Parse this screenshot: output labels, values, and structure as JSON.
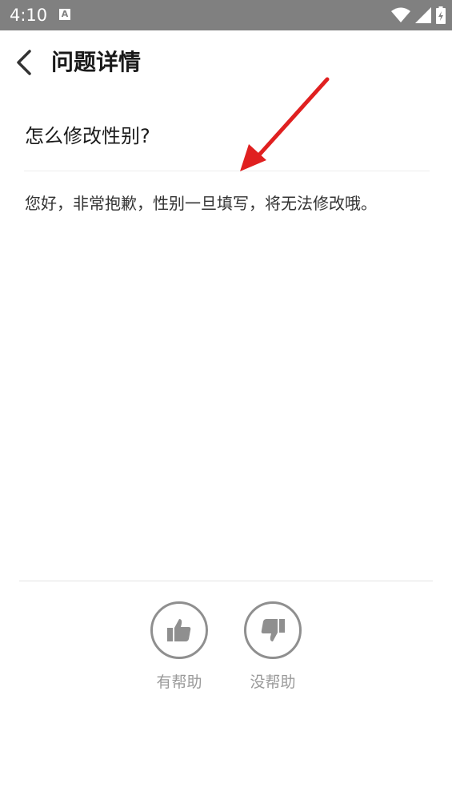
{
  "status_bar": {
    "time": "4:10",
    "notification_icon": "a-letter-icon",
    "icons": [
      "wifi-icon",
      "signal-icon",
      "battery-icon"
    ]
  },
  "header": {
    "title": "问题详情",
    "back_icon": "chevron-left-icon"
  },
  "question": {
    "title": "怎么修改性别?",
    "answer": "您好，非常抱歉，性别一旦填写，将无法修改哦。"
  },
  "feedback": {
    "helpful_label": "有帮助",
    "not_helpful_label": "没帮助"
  },
  "colors": {
    "status_bar": "#808080",
    "annotation_arrow": "#e02020",
    "feedback_icon": "#8f8f8f"
  }
}
